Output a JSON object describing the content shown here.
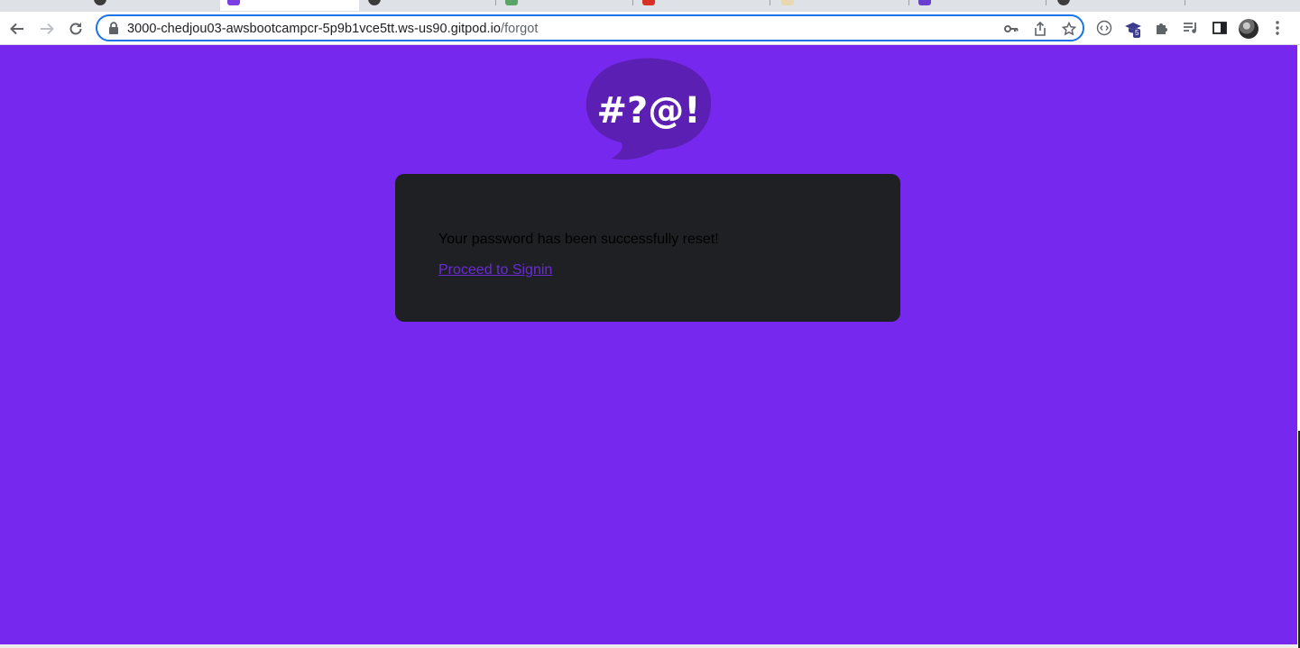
{
  "browser": {
    "address_bar": {
      "host": "3000-chedjou03-awsbootcampcr-5p9b1vce5tt.ws-us90.gitpod.io",
      "path": "/forgot"
    },
    "extension_badge": "5",
    "tab_favicon_colors": [
      "#3c3c3c",
      "#7b3fe4",
      "#3c3c3c",
      "#5aa469",
      "#d93025",
      "#e8d8b0",
      "#6a3fd0",
      "#3c3c3c"
    ]
  },
  "page": {
    "background_color": "#7628ee",
    "logo_text": "#?@!",
    "card": {
      "message": "Your password has been successfully reset!",
      "proceed_link": "Proceed to Signin"
    }
  }
}
